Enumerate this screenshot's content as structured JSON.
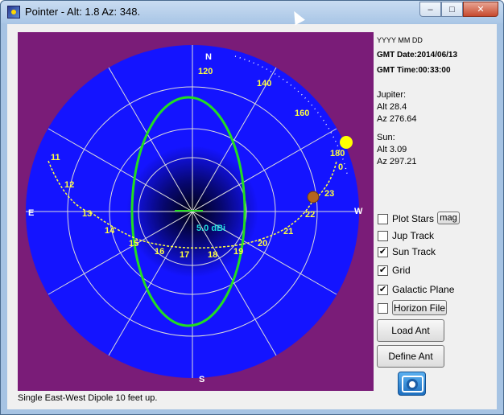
{
  "window": {
    "title": "Pointer - Alt: 1.8  Az: 348."
  },
  "controls": {
    "minimize": "–",
    "maximize": "□",
    "close": "✕"
  },
  "plot": {
    "directions": {
      "n": "N",
      "s": "S",
      "e": "E",
      "w": "W"
    },
    "gain_label": "5.0 dBi",
    "azimuth_ticks": [
      "120",
      "140",
      "160",
      "180",
      "0"
    ],
    "sun_hours": [
      "11",
      "12",
      "13",
      "14",
      "15",
      "16",
      "17",
      "18",
      "19",
      "20",
      "21",
      "22",
      "23"
    ],
    "colors": {
      "background": "#7a1c78",
      "sky": "#1414ff",
      "track": "#ffff40",
      "pattern": "#22dd22",
      "grid": "#dcdcdc",
      "gain": "#22e0e0"
    }
  },
  "info": {
    "date_format": "YYYY MM DD",
    "gmt_date": "GMT Date:2014/06/13",
    "gmt_time": "GMT Time:00:33:00",
    "jupiter": {
      "label": "Jupiter:",
      "alt": "Alt 28.4",
      "az": "Az 276.64"
    },
    "sun": {
      "label": "Sun:",
      "alt": "Alt 3.09",
      "az": "Az 297.21"
    }
  },
  "options": {
    "plot_stars": {
      "label": "Plot Stars",
      "checked": false
    },
    "mag_button": "mag",
    "jup_track": {
      "label": "Jup Track",
      "checked": false
    },
    "sun_track": {
      "label": "Sun Track",
      "checked": true
    },
    "grid": {
      "label": "Grid",
      "checked": true
    },
    "galactic_plane": {
      "label": "Galactic Plane",
      "checked": true
    },
    "horizon_file": {
      "checked": false
    },
    "horizon_button": "Horizon File"
  },
  "buttons": {
    "load_ant": "Load Ant",
    "define_ant": "Define Ant"
  },
  "status": "Single East-West Dipole 10 feet up."
}
